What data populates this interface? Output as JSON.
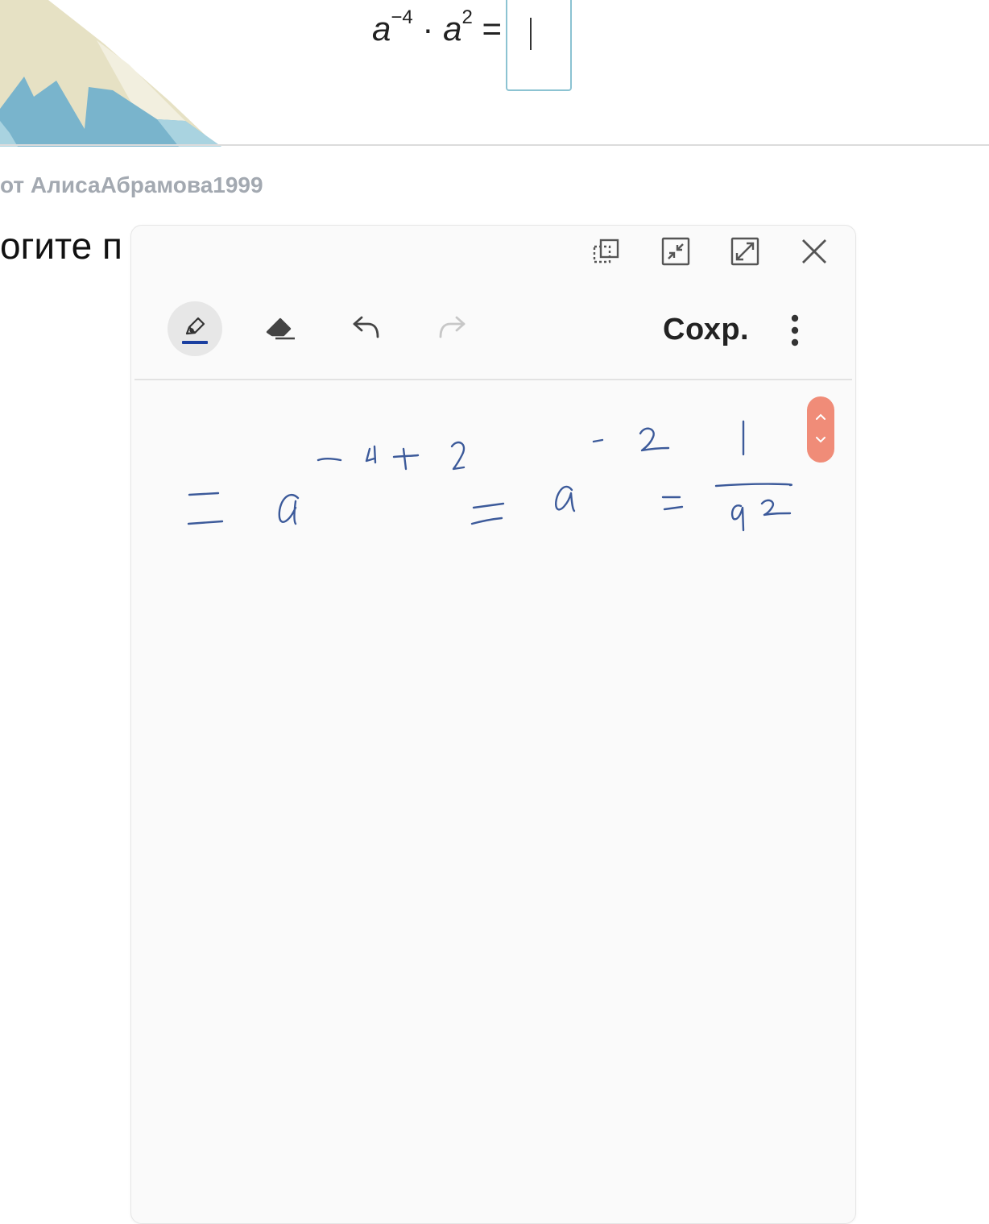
{
  "task": {
    "formula": {
      "base1": "a",
      "exp1": "−4",
      "dot": "·",
      "base2": "a",
      "exp2": "2",
      "equals": "="
    }
  },
  "author_line": "от АлисаАбрамова1999",
  "question_text": "огите п",
  "notepad": {
    "icons": {
      "copy": "copy-region-icon",
      "minimize": "minimize-icon",
      "maximize": "maximize-icon",
      "close": "close-icon",
      "pen": "pen-icon",
      "eraser": "eraser-icon",
      "undo": "undo-icon",
      "redo": "redo-icon",
      "more": "more-vertical-icon",
      "scroll_up": "chevron-up-icon",
      "scroll_down": "chevron-down-icon"
    },
    "save_label": "Сохр.",
    "pen_color": "#1a3fa0",
    "ink_color": "#3c5a9a",
    "scroll_color": "#f08c78"
  }
}
